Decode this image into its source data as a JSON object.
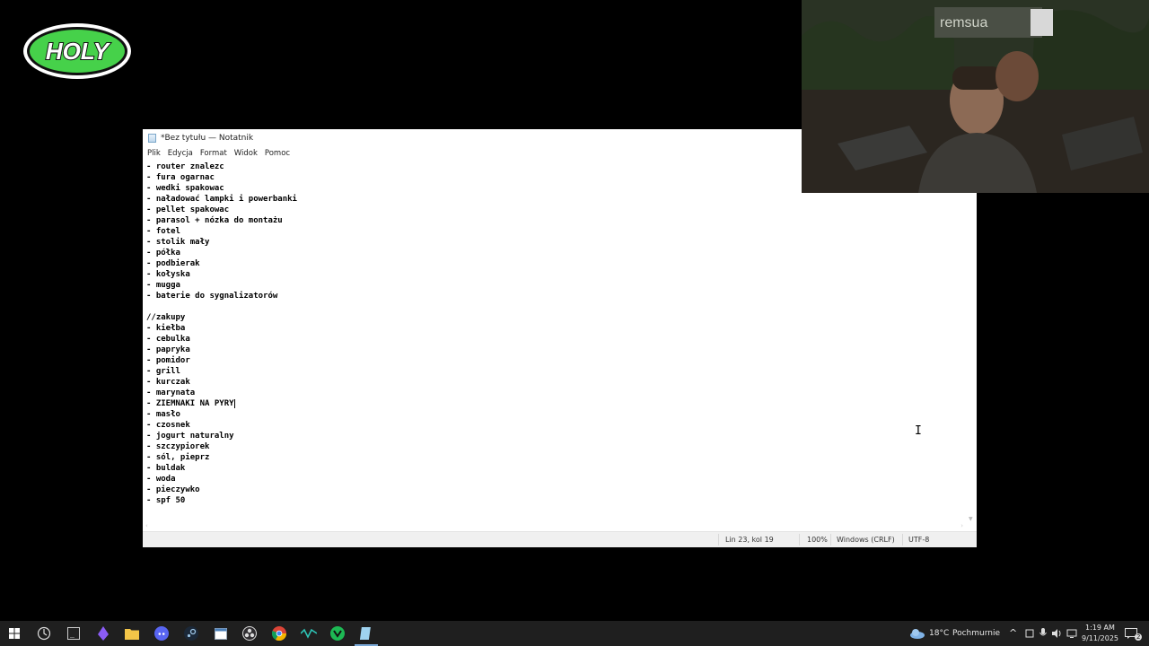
{
  "overlay": {
    "logo_text": "HOLY",
    "channel_text": "remsua"
  },
  "notepad": {
    "title": "*Bez tytułu — Notatnik",
    "menu": [
      "Plik",
      "Edycja",
      "Format",
      "Widok",
      "Pomoc"
    ],
    "lines": [
      "- router znalezc",
      "- fura ogarnac",
      "- wedki spakowac",
      "- naładować lampki i powerbanki",
      "- pellet spakowac",
      "- parasol + nózka do montażu",
      "- fotel",
      "- stolik mały",
      "- półka",
      "- podbierak",
      "- kołyska",
      "- mugga",
      "- baterie do sygnalizatorów",
      "",
      "//zakupy",
      "- kiełba",
      "- cebulka",
      "- papryka",
      "- pomidor",
      "- grill",
      "- kurczak",
      "- marynata",
      "- ZIEMNAKI NA PYRY",
      "- masło",
      "- czosnek",
      "- jogurt naturalny",
      "- szczypiorek",
      "- sól, pieprz",
      "- buldak",
      "- woda",
      "- pieczywko",
      "- spf 50"
    ],
    "status": {
      "position": "Lin 23, kol 19",
      "zoom": "100%",
      "line_ending": "Windows (CRLF)",
      "encoding": "UTF-8"
    }
  },
  "taskbar": {
    "icons": [
      "windows-start-icon",
      "task-view-icon",
      "terminal-icon",
      "app-purple-icon",
      "discord-icon",
      "steam-icon",
      "file-explorer-icon",
      "calendar-app-icon",
      "obs-icon",
      "chrome-icon",
      "media-app-icon",
      "green-app-icon",
      "notepad-icon"
    ],
    "weather": {
      "temp": "18°C",
      "condition": "Pochmurnie"
    },
    "time": "1:19 AM",
    "date": "9/11/2025",
    "notifications": "2"
  },
  "colors": {
    "logo_green": "#4cd64c",
    "taskbar": "#1f1f1f",
    "accent": "#7aa8d6"
  }
}
